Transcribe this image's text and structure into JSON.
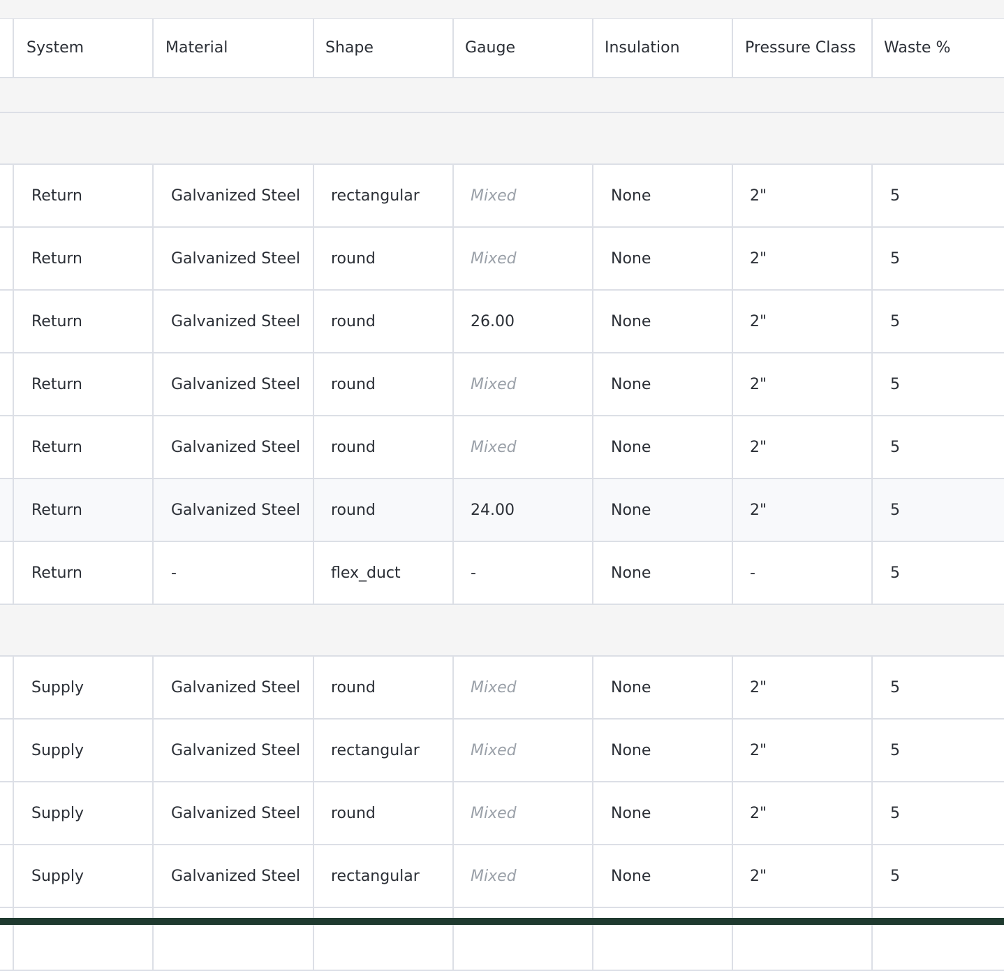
{
  "columns": [
    "System",
    "Material",
    "Shape",
    "Gauge",
    "Insulation",
    "Pressure Class",
    "Waste %"
  ],
  "return_rows": [
    {
      "system": "Return",
      "material": "Galvanized Steel",
      "shape": "rectangular",
      "gauge": "Mixed",
      "gauge_mixed": true,
      "insulation": "None",
      "pressure_class": "2\"",
      "waste": "5"
    },
    {
      "system": "Return",
      "material": "Galvanized Steel",
      "shape": "round",
      "gauge": "Mixed",
      "gauge_mixed": true,
      "insulation": "None",
      "pressure_class": "2\"",
      "waste": "5"
    },
    {
      "system": "Return",
      "material": "Galvanized Steel",
      "shape": "round",
      "gauge": "26.00",
      "gauge_mixed": false,
      "insulation": "None",
      "pressure_class": "2\"",
      "waste": "5"
    },
    {
      "system": "Return",
      "material": "Galvanized Steel",
      "shape": "round",
      "gauge": "Mixed",
      "gauge_mixed": true,
      "insulation": "None",
      "pressure_class": "2\"",
      "waste": "5"
    },
    {
      "system": "Return",
      "material": "Galvanized Steel",
      "shape": "round",
      "gauge": "Mixed",
      "gauge_mixed": true,
      "insulation": "None",
      "pressure_class": "2\"",
      "waste": "5"
    },
    {
      "system": "Return",
      "material": "Galvanized Steel",
      "shape": "round",
      "gauge": "24.00",
      "gauge_mixed": false,
      "insulation": "None",
      "pressure_class": "2\"",
      "waste": "5"
    },
    {
      "system": "Return",
      "material": "-",
      "shape": "flex_duct",
      "gauge": "-",
      "gauge_mixed": false,
      "insulation": "None",
      "pressure_class": "-",
      "waste": "5"
    }
  ],
  "supply_rows": [
    {
      "system": "Supply",
      "material": "Galvanized Steel",
      "shape": "round",
      "gauge": "Mixed",
      "gauge_mixed": true,
      "insulation": "None",
      "pressure_class": "2\"",
      "waste": "5"
    },
    {
      "system": "Supply",
      "material": "Galvanized Steel",
      "shape": "rectangular",
      "gauge": "Mixed",
      "gauge_mixed": true,
      "insulation": "None",
      "pressure_class": "2\"",
      "waste": "5"
    },
    {
      "system": "Supply",
      "material": "Galvanized Steel",
      "shape": "round",
      "gauge": "Mixed",
      "gauge_mixed": true,
      "insulation": "None",
      "pressure_class": "2\"",
      "waste": "5"
    },
    {
      "system": "Supply",
      "material": "Galvanized Steel",
      "shape": "rectangular",
      "gauge": "Mixed",
      "gauge_mixed": true,
      "insulation": "None",
      "pressure_class": "2\"",
      "waste": "5"
    }
  ],
  "colors": {
    "muted_text": "#9aa0a8",
    "group_band": "#f5f5f5",
    "bottom_bar": "#1f3a2f"
  }
}
